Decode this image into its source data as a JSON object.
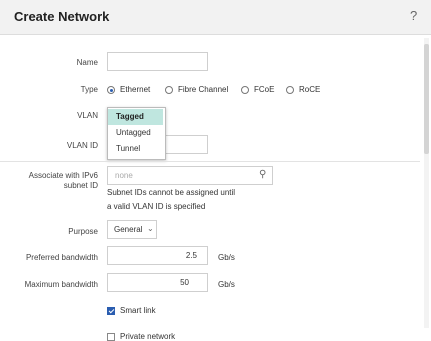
{
  "dialog": {
    "title": "Create Network",
    "help": "?"
  },
  "fields": {
    "name_label": "Name",
    "type_label": "Type",
    "type_options": [
      "Ethernet",
      "Fibre Channel",
      "FCoE",
      "RoCE"
    ],
    "type_selected": "Ethernet",
    "vlan_label": "VLAN",
    "vlan_options": [
      "Tagged",
      "Untagged",
      "Tunnel"
    ],
    "vlan_selected": "Tagged",
    "vlan_id_label": "VLAN ID",
    "ipv6_label": "Associate with IPv6 subnet ID",
    "ipv6_placeholder": "none",
    "ipv6_note_line1": "Subnet IDs cannot be assigned until",
    "ipv6_note_line2": "a valid VLAN ID is specified",
    "purpose_label": "Purpose",
    "purpose_value": "General",
    "preferred_bw_label": "Preferred bandwidth",
    "preferred_bw_value": "2.5",
    "maximum_bw_label": "Maximum bandwidth",
    "maximum_bw_value": "50",
    "bw_unit": "Gb/s",
    "smart_link_label": "Smart link",
    "smart_link_checked": true,
    "private_network_label": "Private network",
    "private_network_checked": false
  }
}
